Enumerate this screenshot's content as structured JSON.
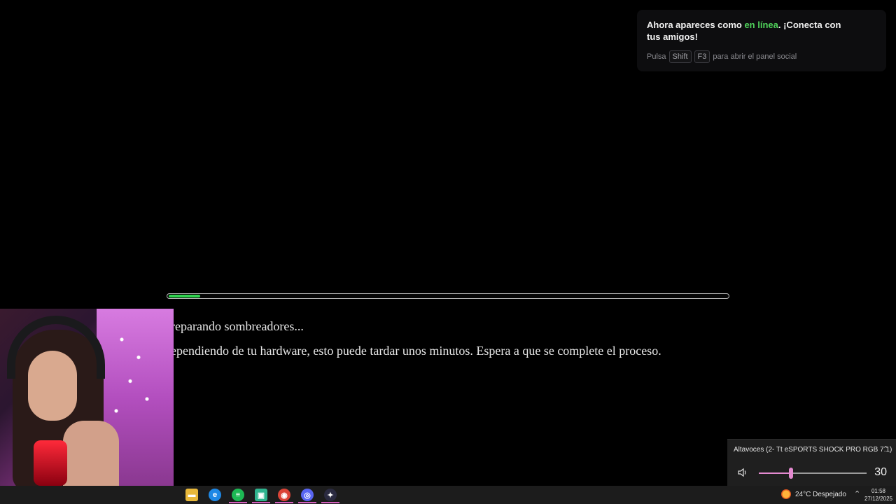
{
  "notification": {
    "message_before": "Ahora apareces como ",
    "status_text": "en línea",
    "message_after": ". ¡Conecta con tus amigos!",
    "hint_press": "Pulsa",
    "key_shift": "Shift",
    "key_f3": "F3",
    "hint_action": "para abrir el panel social",
    "status_color": "#4fd15a"
  },
  "loading": {
    "progress_fraction": 0.056,
    "title": "reparando sombreadores...",
    "subtitle": "ependiendo de tu hardware, esto puede tardar unos minutos. Espera a que se complete el proceso.",
    "progress_color": "#31d34f"
  },
  "volume": {
    "device": "Altavoces (2- Tt eSPORTS SHOCK PRO RGB 7.1)",
    "level": 30,
    "accent_color": "#e48ad0"
  },
  "taskbar": {
    "apps": [
      {
        "name": "file-explorer-icon",
        "color": "#e8b83a"
      },
      {
        "name": "edge-icon",
        "color": "#1e88e5"
      },
      {
        "name": "spotify-icon",
        "color": "#1db954"
      },
      {
        "name": "app-green-icon",
        "color": "#2fb38e"
      },
      {
        "name": "chrome-icon",
        "color": "#db4437"
      },
      {
        "name": "discord-icon",
        "color": "#5865f2"
      },
      {
        "name": "game-launcher-icon",
        "color": "#2a2a40"
      }
    ],
    "weather": "24°C  Despejado",
    "time": "01:58",
    "date": "27/12/2025"
  }
}
